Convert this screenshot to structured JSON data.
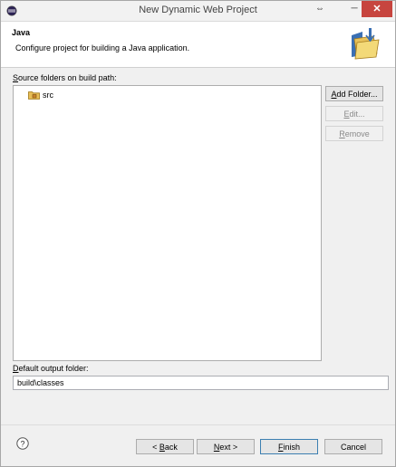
{
  "window": {
    "title": "New Dynamic Web Project"
  },
  "titlebar": {
    "restore_glyph": "⇔",
    "minimize_glyph": "─",
    "close_glyph": "✕"
  },
  "header": {
    "title": "Java",
    "description": "Configure project for building a Java application."
  },
  "source_folders": {
    "label_mnemonic": "S",
    "label_rest": "ource folders on build path:",
    "items": [
      {
        "label": "src",
        "icon": "package-folder-icon"
      }
    ]
  },
  "side_buttons": [
    {
      "mnemonic": "A",
      "rest": "dd Folder...",
      "enabled": true
    },
    {
      "mnemonic": "E",
      "rest": "dit...",
      "enabled": false
    },
    {
      "mnemonic": "R",
      "rest": "emove",
      "enabled": false
    }
  ],
  "output": {
    "label_mnemonic": "D",
    "label_rest": "efault output folder:",
    "value": "build\\classes"
  },
  "footer": {
    "help_icon": "help-icon",
    "back_prefix": "< ",
    "back_mnemonic": "B",
    "back_rest": "ack",
    "next_mnemonic": "N",
    "next_rest": "ext >",
    "finish_mnemonic": "F",
    "finish_rest": "inish",
    "cancel_label": "Cancel"
  },
  "colors": {
    "close_button": "#c7453f",
    "default_button_border": "#3c7fb1"
  }
}
